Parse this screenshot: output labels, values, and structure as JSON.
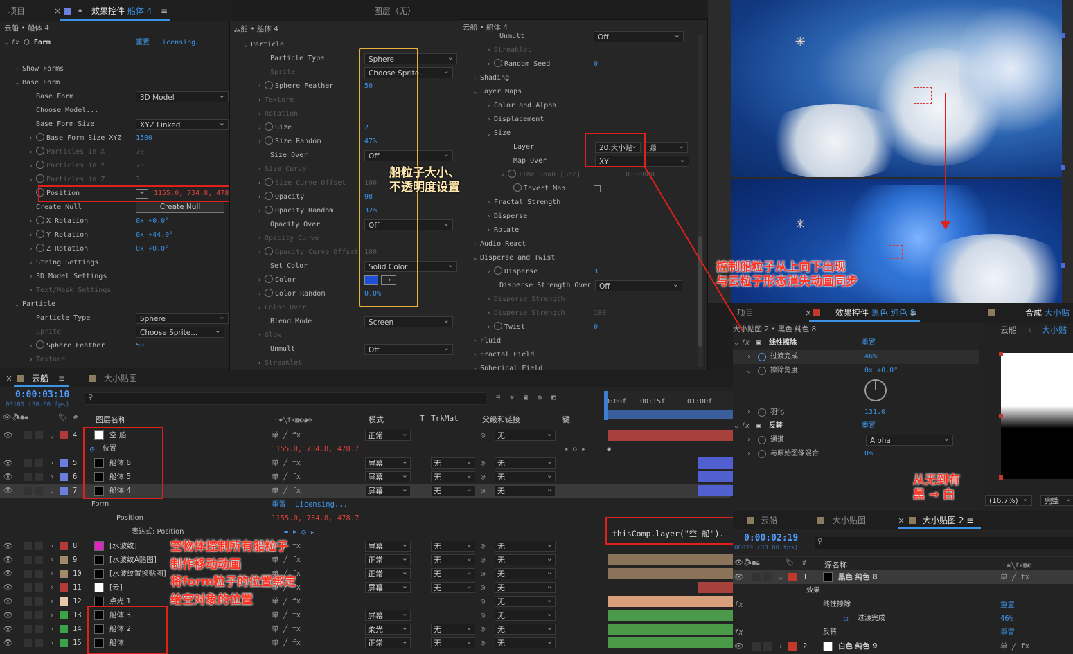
{
  "left_panel": {
    "tab_project": "项目",
    "tab_effects_prefix": "效果控件",
    "tab_effects_layer": "船体 4",
    "tab_menu": "≡",
    "breadcrumb": "云船 • 船体 4",
    "fx": "fx",
    "effect_name": "Form",
    "reset": "重置",
    "licensing": "Licensing...",
    "rows": [
      {
        "label": "Show Forms"
      },
      {
        "label": "Base Form"
      },
      {
        "label": "Base Form",
        "value": "3D Model"
      },
      {
        "label": "Choose Model..."
      },
      {
        "label": "Base Form Size",
        "value": "XYZ Linked"
      },
      {
        "label": "Base Form Size XYZ",
        "value": "1500"
      },
      {
        "label": "Particles in X",
        "value": "70"
      },
      {
        "label": "Particles in Y",
        "value": "70"
      },
      {
        "label": "Particles in Z",
        "value": "3"
      },
      {
        "label": "Position",
        "value": "1155.0, 734.8, 478.7"
      },
      {
        "label": "Create Null",
        "value": "Create Null"
      },
      {
        "label": "X Rotation",
        "value": "0x +0.0°"
      },
      {
        "label": "Y Rotation",
        "value": "0x +44.0°"
      },
      {
        "label": "Z Rotation",
        "value": "0x +0.0°"
      },
      {
        "label": "String Settings"
      },
      {
        "label": "3D Model Settings"
      },
      {
        "label": "Text/Mask Settings"
      },
      {
        "label": "Particle"
      },
      {
        "label": "Particle Type",
        "value": "Sphere"
      },
      {
        "label": "Sprite",
        "value": "Choose Sprite..."
      },
      {
        "label": "Sphere Feather",
        "value": "50"
      },
      {
        "label": "Texture"
      }
    ]
  },
  "mid_panel": {
    "breadcrumb": "云船 • 船体 4",
    "rows": [
      {
        "label": "Particle"
      },
      {
        "label": "Particle Type",
        "value": "Sphere"
      },
      {
        "label": "Sprite",
        "value": "Choose Sprite..."
      },
      {
        "label": "Sphere Feather",
        "value": "50"
      },
      {
        "label": "Texture"
      },
      {
        "label": "Rotation"
      },
      {
        "label": "Size",
        "value": "2"
      },
      {
        "label": "Size Random",
        "value": "47%"
      },
      {
        "label": "Size Over",
        "value": "Off"
      },
      {
        "label": "Size Curve"
      },
      {
        "label": "Size Curve Offset",
        "value": "100"
      },
      {
        "label": "Opacity",
        "value": "98"
      },
      {
        "label": "Opacity Random",
        "value": "32%"
      },
      {
        "label": "Opacity Over",
        "value": "Off"
      },
      {
        "label": "Opacity Curve"
      },
      {
        "label": "Opacity Curve Offset",
        "value": "100"
      },
      {
        "label": "Set Color",
        "value": "Solid Color"
      },
      {
        "label": "Color"
      },
      {
        "label": "Color Random",
        "value": "0.0%"
      },
      {
        "label": "Color Over"
      },
      {
        "label": "Blend Mode",
        "value": "Screen"
      },
      {
        "label": "Glow"
      },
      {
        "label": "Unmult",
        "value": "Off"
      },
      {
        "label": "Streaklet"
      },
      {
        "label": "Random Seed",
        "value": "0"
      }
    ]
  },
  "right_panel": {
    "breadcrumb": "云船 • 船体 4",
    "rows": [
      {
        "label": "Unmult",
        "value": "Off"
      },
      {
        "label": "Streaklet"
      },
      {
        "label": "Random Seed",
        "value": "0"
      },
      {
        "label": "Shading"
      },
      {
        "label": "Layer Maps"
      },
      {
        "label": "Color and Alpha"
      },
      {
        "label": "Displacement"
      },
      {
        "label": "Size"
      },
      {
        "label": "Layer",
        "value": "20.大小贴",
        "value2": "源"
      },
      {
        "label": "Map Over",
        "value": "XY"
      },
      {
        "label": "Time Span [Sec]",
        "value": "0.00000"
      },
      {
        "label": "Invert Map"
      },
      {
        "label": "Fractal Strength"
      },
      {
        "label": "Disperse"
      },
      {
        "label": "Rotate"
      },
      {
        "label": "Audio React"
      },
      {
        "label": "Disperse and Twist"
      },
      {
        "label": "Disperse",
        "value": "3"
      },
      {
        "label": "Disperse Strength Over",
        "value": "Off"
      },
      {
        "label": "Disperse Strength"
      },
      {
        "label": "Disperse Strength",
        "value": "100"
      },
      {
        "label": "Twist",
        "value": "0"
      },
      {
        "label": "Fluid"
      },
      {
        "label": "Fractal Field"
      },
      {
        "label": "Spherical Field"
      }
    ]
  },
  "comp_tabs": {
    "comp_prefix": "合成",
    "comp_name": "云船",
    "layer_tab": "图层（无）"
  },
  "timeline": {
    "tab_comp": "云船",
    "tab_other": "大小贴图",
    "timecode": "0:00:03:10",
    "frames": "00100 (30.00 fps)",
    "col_name": "图层名称",
    "col_mode": "模式",
    "col_t": "T",
    "col_trkmat": "TrkMat",
    "col_parent": "父级和链接",
    "col_key": "键",
    "ruler": [
      "0:00f",
      "00:15f",
      "01:00f"
    ],
    "layers": [
      {
        "num": "4",
        "name": "空 船",
        "mode": "正常",
        "trk": "",
        "parent": "无"
      },
      {
        "sub": "位置",
        "value": "1155.0, 734.8, 478.7"
      },
      {
        "num": "5",
        "name": "船体 6",
        "mode": "屏幕",
        "trk": "无",
        "parent": "无"
      },
      {
        "num": "6",
        "name": "船体 5",
        "mode": "屏幕",
        "trk": "无",
        "parent": "无"
      },
      {
        "num": "7",
        "name": "船体 4",
        "mode": "屏幕",
        "trk": "无",
        "parent": "无"
      },
      {
        "sub": "Form",
        "value": "重置",
        "value2": "Licensing..."
      },
      {
        "sub": "Position",
        "value": "1155.0, 734.8, 478.7"
      },
      {
        "sub": "表达式: Position",
        "value": "thisComp.layer(\"空 船\")."
      },
      {
        "num": "8",
        "name": "[水波纹]",
        "mode": "屏幕",
        "trk": "无",
        "parent": "无"
      },
      {
        "num": "9",
        "name": "[水波纹A贴图]",
        "mode": "正常",
        "trk": "无",
        "parent": "无"
      },
      {
        "num": "10",
        "name": "[水波纹置换贴图]",
        "mode": "正常",
        "trk": "无",
        "parent": "无"
      },
      {
        "num": "11",
        "name": "[云]",
        "mode": "屏幕",
        "trk": "无",
        "parent": "无"
      },
      {
        "num": "12",
        "name": "点光 1",
        "mode": "",
        "trk": "",
        "parent": "无"
      },
      {
        "num": "13",
        "name": "船体 3",
        "mode": "屏幕",
        "trk": "",
        "parent": "无"
      },
      {
        "num": "14",
        "name": "船体 2",
        "mode": "柔光",
        "trk": "无",
        "parent": "无"
      },
      {
        "num": "15",
        "name": "船体",
        "mode": "正常",
        "trk": "无",
        "parent": "无"
      }
    ]
  },
  "bottom_right": {
    "tab_project": "项目",
    "tab_effects_prefix": "效果控件",
    "tab_effects_layer": "黑色 纯色 8",
    "tab_comp_prefix": "合成",
    "tab_comp_name": "大小贴",
    "breadcrumb": "大小贴图 2 • 黑色 纯色 8",
    "comp_breadcrumb1": "云船",
    "comp_breadcrumb2": "大小贴",
    "effects": [
      {
        "label": "线性擦除",
        "value": "重置"
      },
      {
        "label": "过渡完成",
        "value": "46%"
      },
      {
        "label": "擦除角度",
        "value": "0x +0.0°"
      },
      {
        "label": "羽化",
        "value": "131.0"
      },
      {
        "label": "反转",
        "value": "重置"
      },
      {
        "label": "通道",
        "value": "Alpha"
      },
      {
        "label": "与原始图像混合",
        "value": "0%"
      }
    ],
    "zoom": "(16.7%)",
    "quality": "完整",
    "tl_tabs": [
      "云船",
      "大小贴图",
      "大小贴图 2"
    ],
    "timecode": "0:00:02:19",
    "frames": "00079 (30.00 fps)",
    "col_name": "源名称",
    "layers": [
      {
        "num": "1",
        "name": "黑色 纯色 8"
      },
      {
        "sub": "效果"
      },
      {
        "sub": "线性擦除",
        "value": "重置"
      },
      {
        "sub": "过渡完成",
        "value": "46%"
      },
      {
        "sub": "反转",
        "value": "重置"
      },
      {
        "num": "2",
        "name": "白色 纯色 9"
      }
    ]
  },
  "annotations": {
    "size_opacity": "船粒子大小、\n不透明度设置",
    "control": "控制船粒子从上向下出现\n与云粒子形态消失动画同步",
    "null_ctrl": "空物体控制所有船粒子\n制作移动动画\n将form粒子的位置绑定\n给空对象的位置",
    "black_white": "从无到有\n黑 → 白"
  },
  "colors": {
    "accent": "#3d94e6",
    "red": "#e0201a",
    "yellow": "#e8b13a",
    "annotation": "#ff2a1a"
  }
}
